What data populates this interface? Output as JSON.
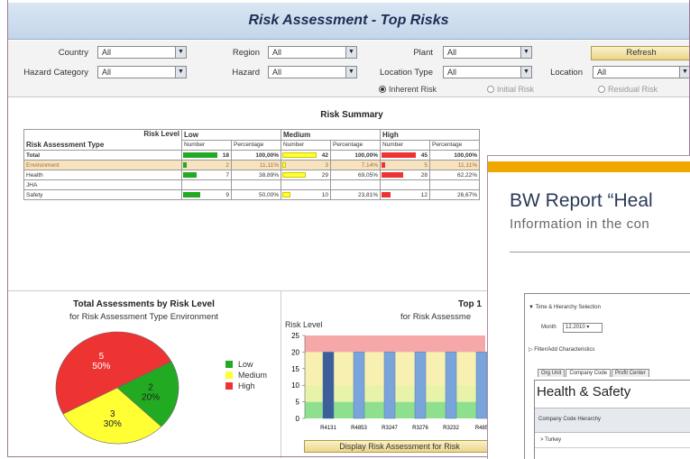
{
  "header": {
    "title": "Risk Assessment - Top Risks"
  },
  "filters": {
    "country": {
      "label": "Country",
      "value": "All"
    },
    "region": {
      "label": "Region",
      "value": "All"
    },
    "plant": {
      "label": "Plant",
      "value": "All"
    },
    "hazard_category": {
      "label": "Hazard Category",
      "value": "All"
    },
    "hazard": {
      "label": "Hazard",
      "value": "All"
    },
    "location_type": {
      "label": "Location Type",
      "value": "All"
    },
    "location": {
      "label": "Location",
      "value": "All"
    },
    "refresh_label": "Refresh"
  },
  "risk_options": [
    {
      "label": "Inherent Risk",
      "selected": true
    },
    {
      "label": "Initial Risk",
      "selected": false
    },
    {
      "label": "Residual Risk",
      "selected": false
    }
  ],
  "summary": {
    "title": "Risk Summary",
    "corner_top": "Risk Level",
    "corner_bottom": "Risk Assessment Type",
    "levels": [
      "Low",
      "Medium",
      "High"
    ],
    "sub_headers": [
      "Number",
      "Percentage"
    ],
    "rows": [
      {
        "type": "Total",
        "low_n": "18",
        "low_p": "100,00%",
        "med_n": "42",
        "med_p": "100,00%",
        "high_n": "45",
        "high_p": "100,00%",
        "low_f": 1.0,
        "med_f": 1.0,
        "high_f": 1.0
      },
      {
        "type": "Environment",
        "low_n": "2",
        "low_p": "11,11%",
        "med_n": "3",
        "med_p": "7,14%",
        "high_n": "5",
        "high_p": "11,11%",
        "low_f": 0.111,
        "med_f": 0.071,
        "high_f": 0.111
      },
      {
        "type": "Health",
        "low_n": "7",
        "low_p": "38,89%",
        "med_n": "29",
        "med_p": "69,05%",
        "high_n": "28",
        "high_p": "62,22%",
        "low_f": 0.389,
        "med_f": 0.69,
        "high_f": 0.622
      },
      {
        "type": "JHA",
        "low_n": "",
        "low_p": "",
        "med_n": "",
        "med_p": "",
        "high_n": "",
        "high_p": "",
        "low_f": 0,
        "med_f": 0,
        "high_f": 0
      },
      {
        "type": "Safety",
        "low_n": "9",
        "low_p": "50,00%",
        "med_n": "10",
        "med_p": "23,81%",
        "high_n": "12",
        "high_p": "26,67%",
        "low_f": 0.5,
        "med_f": 0.238,
        "high_f": 0.267
      }
    ]
  },
  "colors": {
    "low": "#22aa22",
    "medium": "#ffff33",
    "high": "#ee3333",
    "bar": "#7aa5dc",
    "bar_dark": "#3c5f99"
  },
  "chart_data": [
    {
      "type": "pie",
      "title": "Total Assessments by Risk Level",
      "subtitle": "for Risk Assessment Type Environment",
      "slices": [
        {
          "name": "Low",
          "value": 2,
          "percent": "20%",
          "color": "#22aa22"
        },
        {
          "name": "Medium",
          "value": 3,
          "percent": "30%",
          "color": "#ffff33"
        },
        {
          "name": "High",
          "value": 5,
          "percent": "50%",
          "color": "#ee3333"
        }
      ],
      "legend": [
        "Low",
        "Medium",
        "High"
      ]
    },
    {
      "type": "bar",
      "title": "Top 1",
      "subtitle": "for Risk Assessme",
      "ylabel": "Risk Level",
      "ylim": [
        0,
        25
      ],
      "yticks": [
        "0",
        "5",
        "10",
        "15",
        "20",
        "25"
      ],
      "bands": [
        {
          "from": 0,
          "to": 5,
          "color": "#8ee08e"
        },
        {
          "from": 5,
          "to": 10,
          "color": "#e8f2a8"
        },
        {
          "from": 10,
          "to": 20,
          "color": "#f8f0b0"
        },
        {
          "from": 20,
          "to": 25,
          "color": "#f6a8a8"
        }
      ],
      "categories": [
        "R4131",
        "R4853",
        "R3247",
        "R3276",
        "R3232",
        "R485"
      ],
      "values": [
        20,
        20,
        20,
        20,
        20,
        20
      ]
    }
  ],
  "display_button": "Display Risk Assessment for Risk",
  "overlay": {
    "title": "BW Report “Heal",
    "subtitle": "Information  in the con",
    "time_selection": "Time & Hierarchy Selection",
    "month_label": "Month",
    "month_value": "12.2010",
    "filter_label": "Filter/Add Characteristics",
    "tabs": [
      "Org Unit",
      "Company Code",
      "Profit Center"
    ],
    "section_title": "Health & Safety",
    "hierarchy_label": "Company Code Hierarchy",
    "row_label": "> Turkey"
  }
}
